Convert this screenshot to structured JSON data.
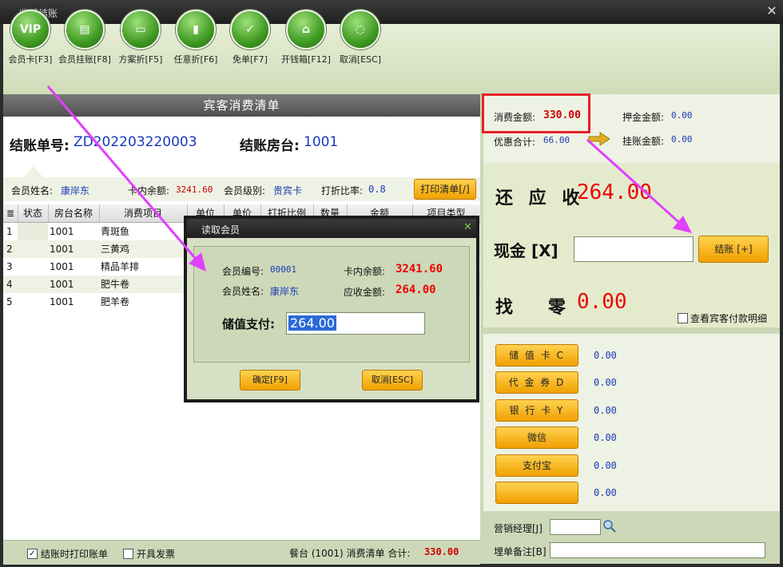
{
  "window": {
    "title": "收银结账"
  },
  "toolbar": [
    {
      "label": "会员卡[F3]",
      "icon": "vip-icon",
      "glyph": "VIP"
    },
    {
      "label": "会员挂账[F8]",
      "icon": "document-icon",
      "glyph": "▤"
    },
    {
      "label": "方案折[F5]",
      "icon": "window-icon",
      "glyph": "▭"
    },
    {
      "label": "任意折[F6]",
      "icon": "paper-icon",
      "glyph": "▮"
    },
    {
      "label": "免单[F7]",
      "icon": "clipboard-check-icon",
      "glyph": "✓"
    },
    {
      "label": "开钱箱[F12]",
      "icon": "cash-drawer-icon",
      "glyph": "⌂"
    },
    {
      "label": "取消[ESC]",
      "icon": "cancel-circle-icon",
      "glyph": "◌"
    }
  ],
  "bill": {
    "header": "宾客消费清单",
    "bill_no_label": "结账单号:",
    "bill_no": "ZD202203220003",
    "room_label": "结账房台:",
    "room": "1001"
  },
  "member_info": {
    "name_label": "会员姓名:",
    "name": "康岸东",
    "balance_label": "卡内余额:",
    "balance": "3241.60",
    "level_label": "会员级别:",
    "level": "贵宾卡",
    "discount_label": "打折比率:",
    "discount": "0.8",
    "print_button": "打印清单[/]"
  },
  "grid": {
    "columns": [
      "状态",
      "房台名称",
      "消费项目",
      "单位",
      "单价",
      "打折比例",
      "数量",
      "金额",
      "项目类型"
    ],
    "rows": [
      {
        "no": "1",
        "room": "1001",
        "item": "青斑鱼"
      },
      {
        "no": "2",
        "room": "1001",
        "item": "三黄鸡"
      },
      {
        "no": "3",
        "room": "1001",
        "item": "精品羊排"
      },
      {
        "no": "4",
        "room": "1001",
        "item": "肥牛卷"
      },
      {
        "no": "5",
        "room": "1001",
        "item": "肥羊卷"
      }
    ]
  },
  "footer": {
    "print_on_checkout": "结账时打印账单",
    "issue_invoice": "开具发票",
    "summary_prefix": "餐台 (1001) 消费清单 合计:",
    "total": "330.00"
  },
  "summary": {
    "consume_label": "消费金额:",
    "consume": "330.00",
    "deposit_label": "押金金额:",
    "deposit": "0.00",
    "discount_total_label": "优惠合计:",
    "discount_total": "66.00",
    "credit_label": "挂账金额:",
    "credit": "0.00"
  },
  "settle": {
    "due_label": "还 应 收",
    "due": "264.00",
    "cash_label": "现金 [X]",
    "cash_value": "",
    "checkout_button": "结账 [+]",
    "change_label": "找　　零",
    "change": "0.00",
    "guest_detail": "查看宾客付款明细"
  },
  "payments": [
    {
      "label": "储 值 卡 C",
      "value": "0.00"
    },
    {
      "label": "代 金 券 D",
      "value": "0.00"
    },
    {
      "label": "银 行 卡 Y",
      "value": "0.00"
    },
    {
      "label": "微信",
      "value": "0.00"
    },
    {
      "label": "支付宝",
      "value": "0.00"
    },
    {
      "label": "",
      "value": "0.00"
    }
  ],
  "bottom": {
    "manager_label": "营销经理[J]",
    "manager_value": "",
    "remark_label": "埋单备注[B]",
    "remark_value": ""
  },
  "dialog": {
    "title": "读取会员",
    "member_no_label": "会员编号:",
    "member_no": "00001",
    "balance_label": "卡内余额:",
    "balance": "3241.60",
    "member_name_label": "会员姓名:",
    "member_name": "康岸东",
    "receivable_label": "应收金额:",
    "receivable": "264.00",
    "stored_pay_label": "储值支付:",
    "stored_pay": "264.00",
    "ok_button": "确定[F9]",
    "cancel_button": "取消[ESC]"
  },
  "colors": {
    "accent_red": "#e00000",
    "value_blue": "#1a3ab8",
    "button_orange": "#f0a000",
    "annotation_magenta": "#e040ff"
  }
}
